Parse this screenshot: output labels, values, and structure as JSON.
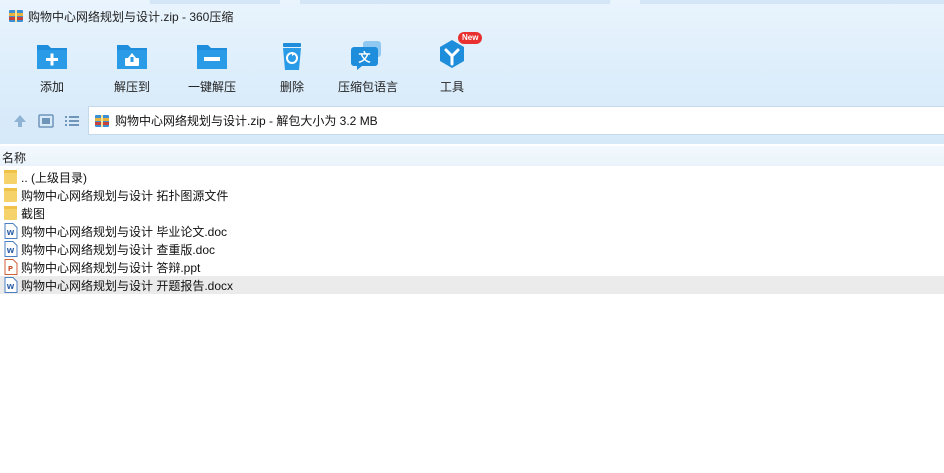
{
  "window": {
    "title": "购物中心网络规划与设计.zip - 360压缩"
  },
  "toolbar": {
    "buttons": [
      {
        "label": "添加",
        "icon": "add-icon"
      },
      {
        "label": "解压到",
        "icon": "extract-to-icon"
      },
      {
        "label": "一键解压",
        "icon": "one-click-extract-icon"
      },
      {
        "label": "删除",
        "icon": "delete-icon"
      },
      {
        "label": "压缩包语言",
        "icon": "archive-language-icon"
      },
      {
        "label": "工具",
        "icon": "tools-icon",
        "badge": "New"
      }
    ]
  },
  "address": {
    "text": "购物中心网络规划与设计.zip - 解包大小为 3.2 MB"
  },
  "list": {
    "column_name": "名称",
    "files": [
      {
        "name": ".. (上级目录)",
        "type": "folder"
      },
      {
        "name": "购物中心网络规划与设计 拓扑图源文件",
        "type": "folder"
      },
      {
        "name": "截图",
        "type": "folder"
      },
      {
        "name": "购物中心网络规划与设计 毕业论文.doc",
        "type": "doc"
      },
      {
        "name": "购物中心网络规划与设计 查重版.doc",
        "type": "doc"
      },
      {
        "name": "购物中心网络规划与设计 答辩.ppt",
        "type": "ppt"
      },
      {
        "name": "购物中心网络规划与设计 开题报告.docx",
        "type": "doc",
        "selected": true
      }
    ]
  },
  "colors": {
    "accent": "#1e8ddb",
    "folder": "#f6d26b",
    "badge": "#e83030"
  }
}
